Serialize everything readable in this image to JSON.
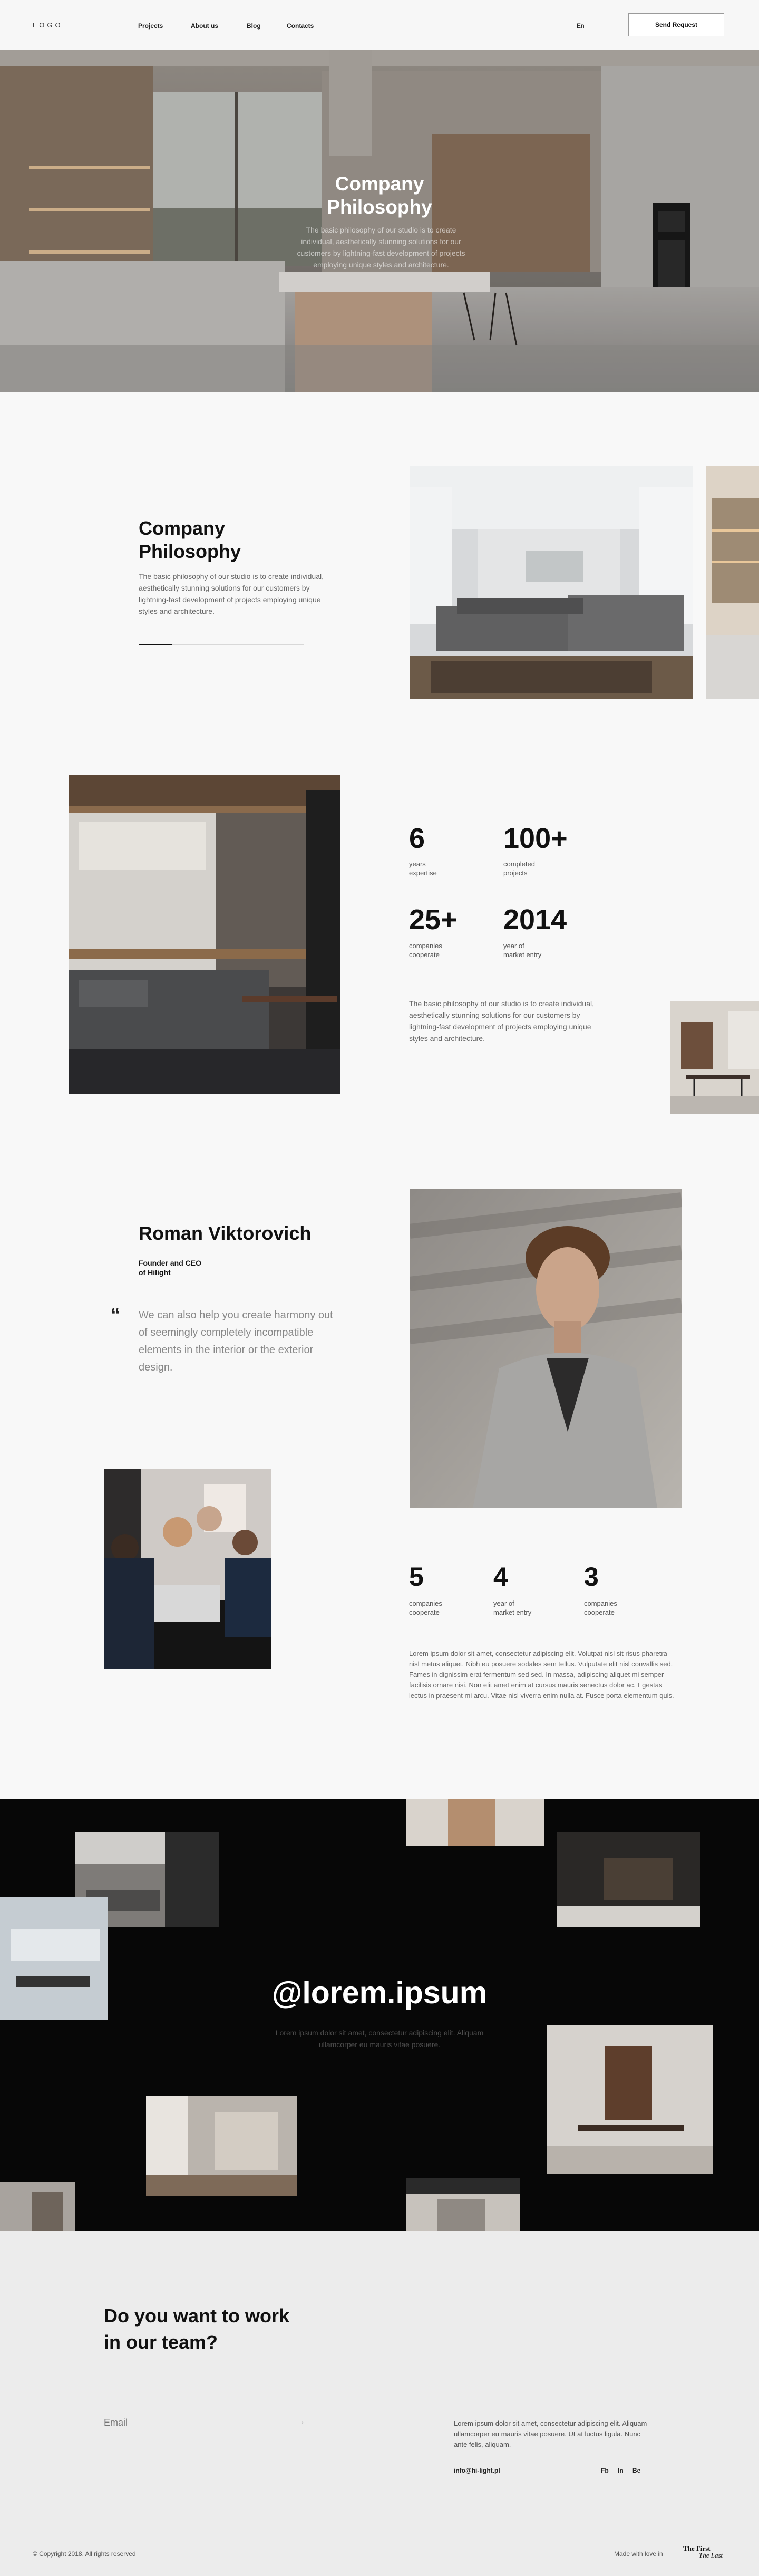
{
  "header": {
    "logo": "LOGO",
    "nav": [
      {
        "label": "Projects"
      },
      {
        "label": "About us"
      },
      {
        "label": "Blog"
      },
      {
        "label": "Contacts"
      }
    ],
    "language": "En",
    "cta_label": "Send Request"
  },
  "hero": {
    "title_line1": "Company",
    "title_line2": "Philosophy",
    "text": "The basic philosophy of our studio is to create individual, aesthetically stunning solutions for our customers by lightning-fast development of projects employing unique styles and architecture."
  },
  "philosophy": {
    "title_line1": "Company",
    "title_line2": "Philosophy",
    "text": "The basic philosophy of our studio is to create individual, aesthetically stunning solutions for our customers by lightning-fast development of projects employing unique styles and architecture.",
    "slider_progress": 0.2
  },
  "stats": {
    "items": [
      {
        "value": "6",
        "label_line1": "years",
        "label_line2": "expertise"
      },
      {
        "value": "100+",
        "label_line1": "completed",
        "label_line2": "projects"
      },
      {
        "value": "25+",
        "label_line1": "companies",
        "label_line2": "cooperate"
      },
      {
        "value": "2014",
        "label_line1": "year of",
        "label_line2": "market entry"
      }
    ],
    "text": "The basic philosophy of our studio is to create individual, aesthetically stunning solutions for our customers by lightning-fast development of projects employing unique styles and architecture."
  },
  "founder": {
    "name": "Roman Viktorovich",
    "role_line1": "Founder and CEO",
    "role_line2": "of Hilight",
    "quote_mark": "“",
    "quote": "We can also help you create harmony out of seemingly completely incompatible elements in the interior or the exterior design."
  },
  "team_stats": {
    "items": [
      {
        "value": "5",
        "label_line1": "companies",
        "label_line2": "cooperate"
      },
      {
        "value": "4",
        "label_line1": "year of",
        "label_line2": "market entry"
      },
      {
        "value": "3",
        "label_line1": "companies",
        "label_line2": "cooperate"
      }
    ],
    "text": "Lorem ipsum dolor sit amet, consectetur adipiscing elit. Volutpat nisl sit risus pharetra nisl metus aliquet. Nibh eu posuere sodales sem tellus. Vulputate elit nisl convallis sed. Fames in dignissim erat fermentum sed sed. In massa, adipiscing aliquet mi semper facilisis ornare nisi. Non elit amet enim at cursus mauris senectus dolor ac. Egestas lectus in praesent mi arcu. Vitae nisl viverra enim nulla at. Fusce porta elementum quis."
  },
  "instagram": {
    "handle": "@lorem.ipsum",
    "text": "Lorem ipsum dolor sit amet, consectetur adipiscing elit. Aliquam ullamcorper eu mauris vitae posuere."
  },
  "join": {
    "title_line1": "Do you want to work",
    "title_line2": "in our team?",
    "email_placeholder": "Email",
    "arrow": "→",
    "text": "Lorem ipsum dolor sit amet, consectetur adipiscing elit. Aliquam ullamcorper eu mauris vitae posuere. Ut at luctus ligula. Nunc ante felis, aliquam.",
    "email": "info@hi-light.pl",
    "socials": [
      "Fb",
      "In",
      "Be"
    ]
  },
  "footer": {
    "copyright": "© Copyright 2018. All rights reserved",
    "made_with": "Made with love in",
    "brand_line1": "The First",
    "brand_line2": "The Last"
  },
  "colors": {
    "background": "#f8f8f8",
    "dark_section": "#070707",
    "join_section": "#ececec",
    "text": "#111111",
    "muted": "#666666"
  }
}
